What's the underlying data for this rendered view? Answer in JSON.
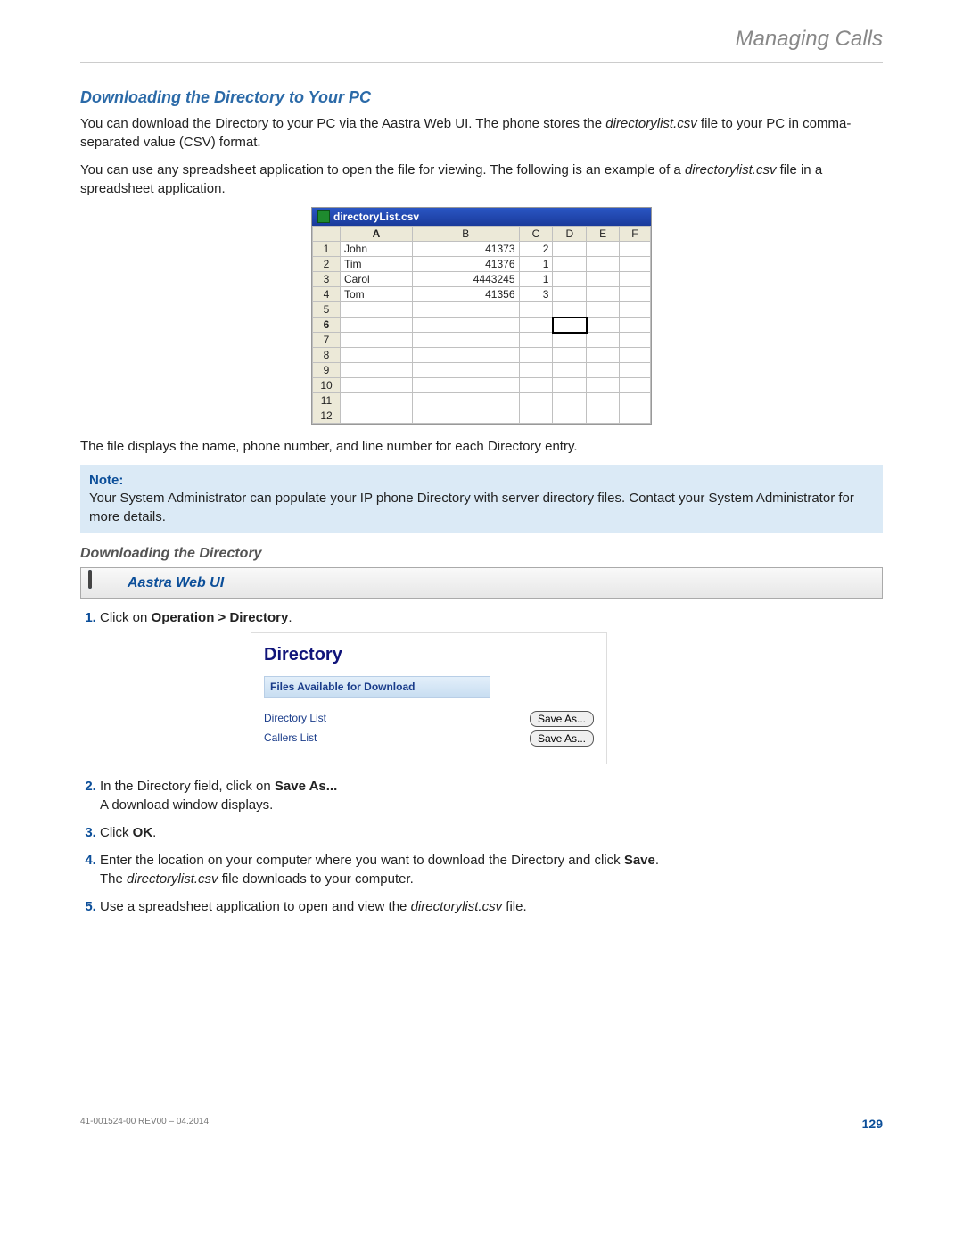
{
  "header": {
    "title": "Managing Calls"
  },
  "section1": {
    "heading": "Downloading the Directory to Your PC",
    "para1_a": "You can download the Directory to your PC via the Aastra Web UI. The phone stores the ",
    "para1_file": "directorylist.csv",
    "para1_b": " file to your PC in comma-separated value (CSV) format.",
    "para2_a": "You can use any spreadsheet application to open the file for viewing. The following is an example of a ",
    "para2_file": "directorylist.csv",
    "para2_b": " file in a spreadsheet application."
  },
  "spreadsheet": {
    "filename": "directoryList.csv",
    "columns": [
      "A",
      "B",
      "C",
      "D",
      "E",
      "F"
    ],
    "row_headers": [
      "1",
      "2",
      "3",
      "4",
      "5",
      "6",
      "7",
      "8",
      "9",
      "10",
      "11",
      "12"
    ],
    "data_rows": [
      {
        "a": "John",
        "b": "41373",
        "c": "2"
      },
      {
        "a": "Tim",
        "b": "41376",
        "c": "1"
      },
      {
        "a": "Carol",
        "b": "4443245",
        "c": "1"
      },
      {
        "a": "Tom",
        "b": "41356",
        "c": "3"
      }
    ],
    "selected": {
      "row": 6,
      "col": "D"
    }
  },
  "after_table": "The file displays the name, phone number, and line number for each Directory entry.",
  "note": {
    "label": "Note:",
    "text": "Your System Administrator can populate your IP phone Directory with server directory files. Contact your System Administrator for more details."
  },
  "section2": {
    "heading": "Downloading the Directory",
    "webui_label": "Aastra Web UI"
  },
  "dir_panel": {
    "title": "Directory",
    "section": "Files Available for Download",
    "rows": [
      {
        "label": "Directory List",
        "button": "Save As..."
      },
      {
        "label": "Callers List",
        "button": "Save As..."
      }
    ]
  },
  "steps": {
    "s1_a": "Click on ",
    "s1_b": "Operation > Directory",
    "s1_c": ".",
    "s2_a": "In the Directory field, click on ",
    "s2_b": "Save As...",
    "s2_line2": "A download window displays.",
    "s3_a": "Click ",
    "s3_b": "OK",
    "s3_c": ".",
    "s4_a": "Enter the location on your computer where you want to download the Directory and click ",
    "s4_b": "Save",
    "s4_c": ".",
    "s4_line2_a": "The ",
    "s4_line2_file": "directorylist.csv",
    "s4_line2_b": " file downloads to your computer.",
    "s5_a": "Use a spreadsheet application to open and view the ",
    "s5_file": "directorylist.csv",
    "s5_b": " file."
  },
  "footer": {
    "left": "41-001524-00 REV00 – 04.2014",
    "page": "129"
  }
}
